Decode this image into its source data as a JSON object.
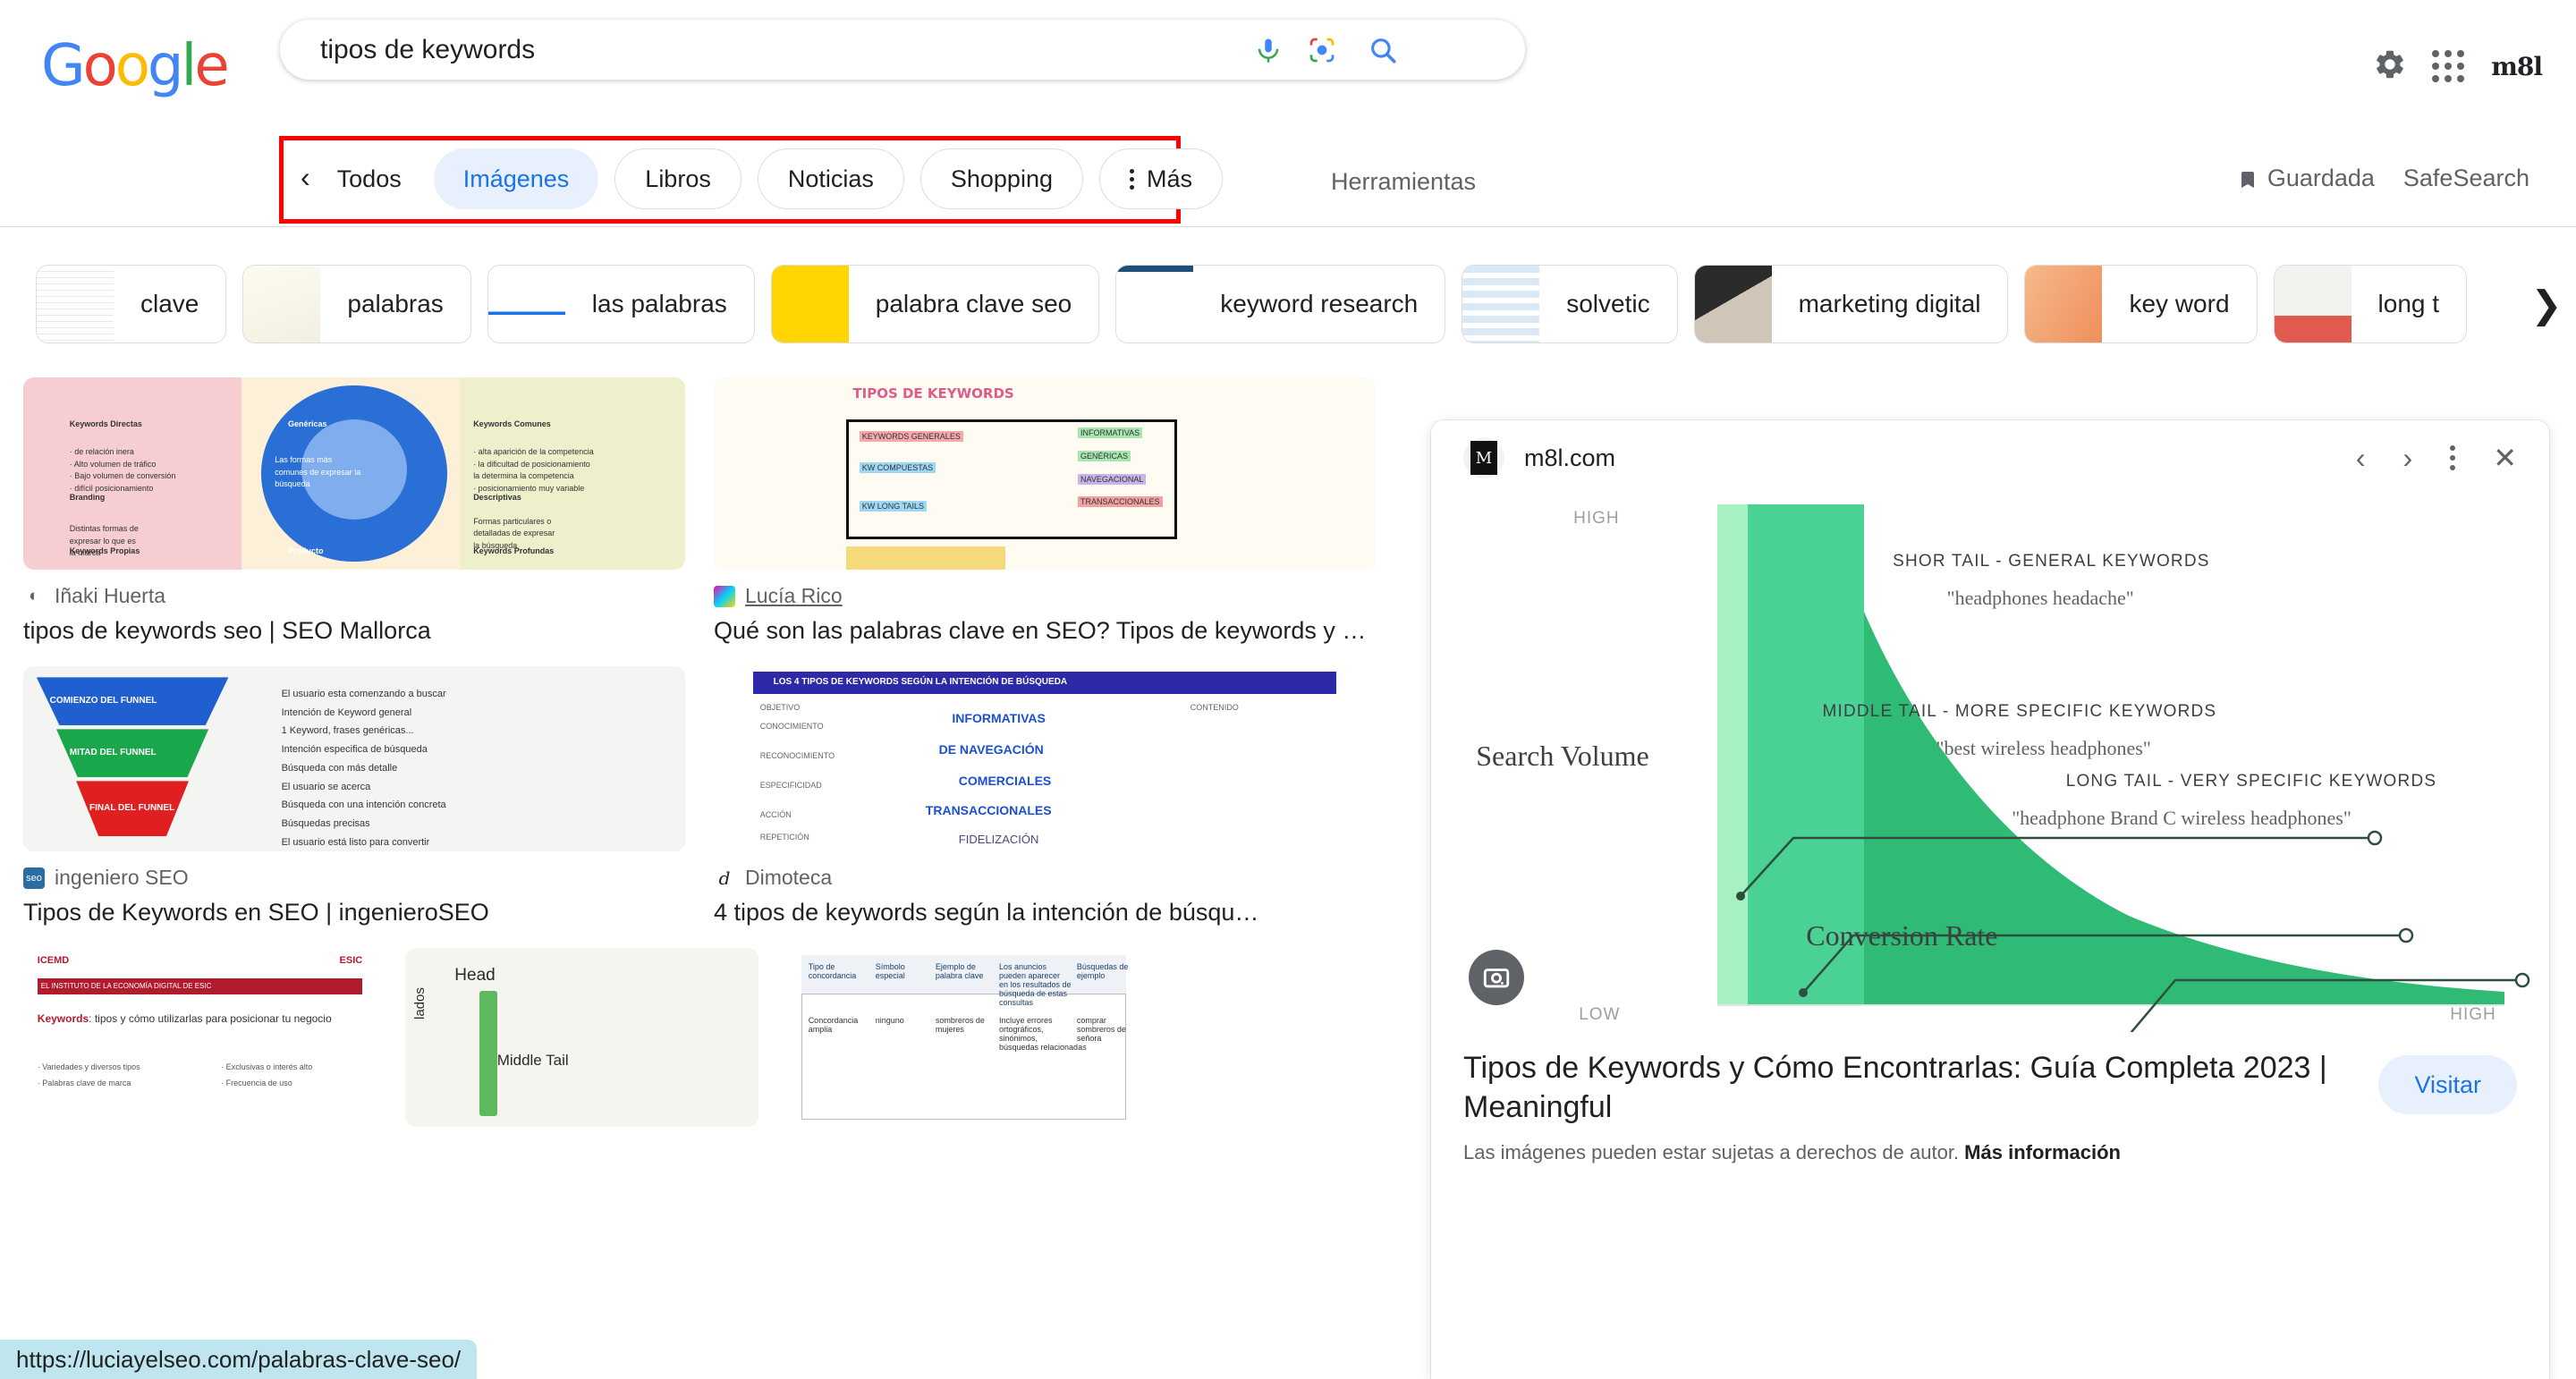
{
  "header": {
    "logo_letters": [
      "G",
      "o",
      "o",
      "g",
      "l",
      "e"
    ],
    "search": {
      "value": "tipos de keywords",
      "placeholder": "Buscar"
    },
    "icons": {
      "mic": "mic-icon",
      "lens": "google-lens-icon",
      "search": "search-icon"
    },
    "account_initials": "m8l"
  },
  "nav": {
    "back_label": "‹",
    "tabs": [
      {
        "label": "Todos",
        "style": "plain",
        "active": false
      },
      {
        "label": "Imágenes",
        "style": "pill",
        "active": true
      },
      {
        "label": "Libros",
        "style": "pill",
        "active": false
      },
      {
        "label": "Noticias",
        "style": "pill",
        "active": false
      },
      {
        "label": "Shopping",
        "style": "pill",
        "active": false
      },
      {
        "label": "Más",
        "style": "pill-kebab",
        "active": false
      }
    ],
    "tools_label": "Herramientas",
    "saved_label": "Guardada",
    "safesearch_label": "SafeSearch",
    "highlight_color": "#ff0000"
  },
  "chips": [
    {
      "label": "clave",
      "thumb": "table-grid"
    },
    {
      "label": "palabras",
      "thumb": "handwritten-map"
    },
    {
      "label": "las palabras",
      "thumb": "webpage"
    },
    {
      "label": "palabra clave seo",
      "thumb": "yellow-diagram"
    },
    {
      "label": "keyword research",
      "thumb": "curve-chart"
    },
    {
      "label": "solvetic",
      "thumb": "blue-flow"
    },
    {
      "label": "marketing digital",
      "thumb": "dice-photo"
    },
    {
      "label": "key word",
      "thumb": "person-photo"
    },
    {
      "label": "long t",
      "thumb": "seo-red-chart"
    }
  ],
  "results": [
    {
      "source": "Iñaki Huerta",
      "title": "tipos de keywords seo | SEO Mallorca",
      "favicon_color": "#5f6368",
      "favicon_text": "◑",
      "underline": false,
      "art": "venn",
      "art_texts": [
        "Keywords Directas",
        "Genéricas",
        "Keywords Comunes",
        "Branding",
        "Descriptivas",
        "Keywords Propias",
        "Producto",
        "Keywords Profundas"
      ]
    },
    {
      "source": "Lucía Rico",
      "title": "Qué son las palabras clave en SEO? Tipos de keywords y c…",
      "favicon_color": "#e91e8c",
      "favicon_text": "■",
      "underline": true,
      "art": "sketch",
      "art_texts": [
        "TIPOS DE KEYWORDS",
        "KEYWORDS GENERALES",
        "KW COMPUESTAS",
        "KW LONG TAILS",
        "INFORMATIVAS",
        "GENÉRICAS",
        "NAVEGACIONAL",
        "TRANSACCIONALES"
      ]
    },
    {
      "source": "ingeniero SEO",
      "title": "Tipos de Keywords en SEO | ingenieroSEO",
      "favicon_color": "#1a73e8",
      "favicon_text": "seo",
      "underline": false,
      "art": "funnel",
      "art_texts": [
        "COMIENZO DEL FUNNEL",
        "MITAD DEL FUNNEL",
        "FINAL DEL FUNNEL",
        "El usuario esta comenzando a buscar",
        "Intención de Keyword general",
        "1 Keyword, frases genéricas...",
        "Intención especifica de búsqueda",
        "Búsqueda con más detalle",
        "El usuario se acerca",
        "Búsqueda con una intención concreta",
        "Búsquedas precisas",
        "El usuario está listo para convertir"
      ]
    },
    {
      "source": "Dimoteca",
      "title": "4 tipos de keywords según la intención de búsqu…",
      "favicon_color": "#ffffff",
      "favicon_text": "d",
      "underline": false,
      "art": "table",
      "art_texts": [
        "LOS 4 TIPOS DE KEYWORDS SEGÚN LA INTENCIÓN DE BÚSQUEDA",
        "INFORMATIVAS",
        "DE NAVEGACIÓN",
        "COMERCIALES",
        "TRANSACCIONALES",
        "FIDELIZACIÓN",
        "OBJETIVO",
        "CONTENIDO",
        "CONOCIMIENTO",
        "RECONOCIMIENTO",
        "ESPECIFICIDAD",
        "ACCIÓN",
        "REPETICIÓN"
      ]
    }
  ],
  "panel": {
    "domain": "m8l.com",
    "favicon_letter": "M",
    "actions": {
      "prev": "‹",
      "next": "›",
      "more": "kebab",
      "close": "✕"
    },
    "title": "Tipos de Keywords y Cómo Encontrarlas: Guía Completa 2023 | Meaningful",
    "visit_label": "Visitar",
    "note_text": "Las imágenes pueden estar sujetas a derechos de autor.",
    "note_link": "Más información",
    "lens_icon": "google-lens-icon"
  },
  "chart_data": {
    "type": "area",
    "title": "",
    "xlabel": "Conversion Rate",
    "ylabel": "Search Volume",
    "x_ticks": [
      "LOW",
      "HIGH"
    ],
    "y_ticks": [
      "HIGH",
      "LOW"
    ],
    "grid": false,
    "legend_position": "none",
    "colors": {
      "band_light": "#a7f0c2",
      "band_mid": "#4ad295",
      "band_dark": "#2fba76",
      "line": "#2f4f3e"
    },
    "bands": [
      {
        "name": "Short tail band",
        "color": "#a7f0c2",
        "x_from": 0.0,
        "x_to": 0.04
      },
      {
        "name": "Middle tail band",
        "color": "#4ad295",
        "x_from": 0.04,
        "x_to": 0.2
      },
      {
        "name": "Long tail band",
        "color": "#2fba76",
        "x_from": 0.2,
        "x_to": 1.0
      }
    ],
    "curve_description": "Steeply decaying power-law curve: search volume very high at low conversion rate, falling rapidly then flattening into a long tail",
    "curve_points": [
      {
        "x": 0.0,
        "y": 1.0
      },
      {
        "x": 0.04,
        "y": 0.86
      },
      {
        "x": 0.08,
        "y": 0.62
      },
      {
        "x": 0.14,
        "y": 0.44
      },
      {
        "x": 0.2,
        "y": 0.33
      },
      {
        "x": 0.32,
        "y": 0.22
      },
      {
        "x": 0.48,
        "y": 0.15
      },
      {
        "x": 0.65,
        "y": 0.1
      },
      {
        "x": 0.82,
        "y": 0.07
      },
      {
        "x": 1.0,
        "y": 0.05
      }
    ],
    "annotations": [
      {
        "heading": "SHOR TAIL - GENERAL KEYWORDS",
        "example": "\"headphones headache\"",
        "anchor_x": 0.022,
        "anchor_y": 0.7
      },
      {
        "heading": "MIDDLE TAIL - MORE SPECIFIC KEYWORDS",
        "example": "\"best wireless headphones\"",
        "anchor_x": 0.095,
        "anchor_y": 0.42
      },
      {
        "heading": "LONG TAIL - VERY SPECIFIC KEYWORDS",
        "example": "\"headphone Brand C wireless headphones\"",
        "anchor_x": 0.43,
        "anchor_y": 0.155
      }
    ]
  },
  "statusbar": {
    "url": "https://luciayelseo.com/palabras-clave-seo/"
  }
}
